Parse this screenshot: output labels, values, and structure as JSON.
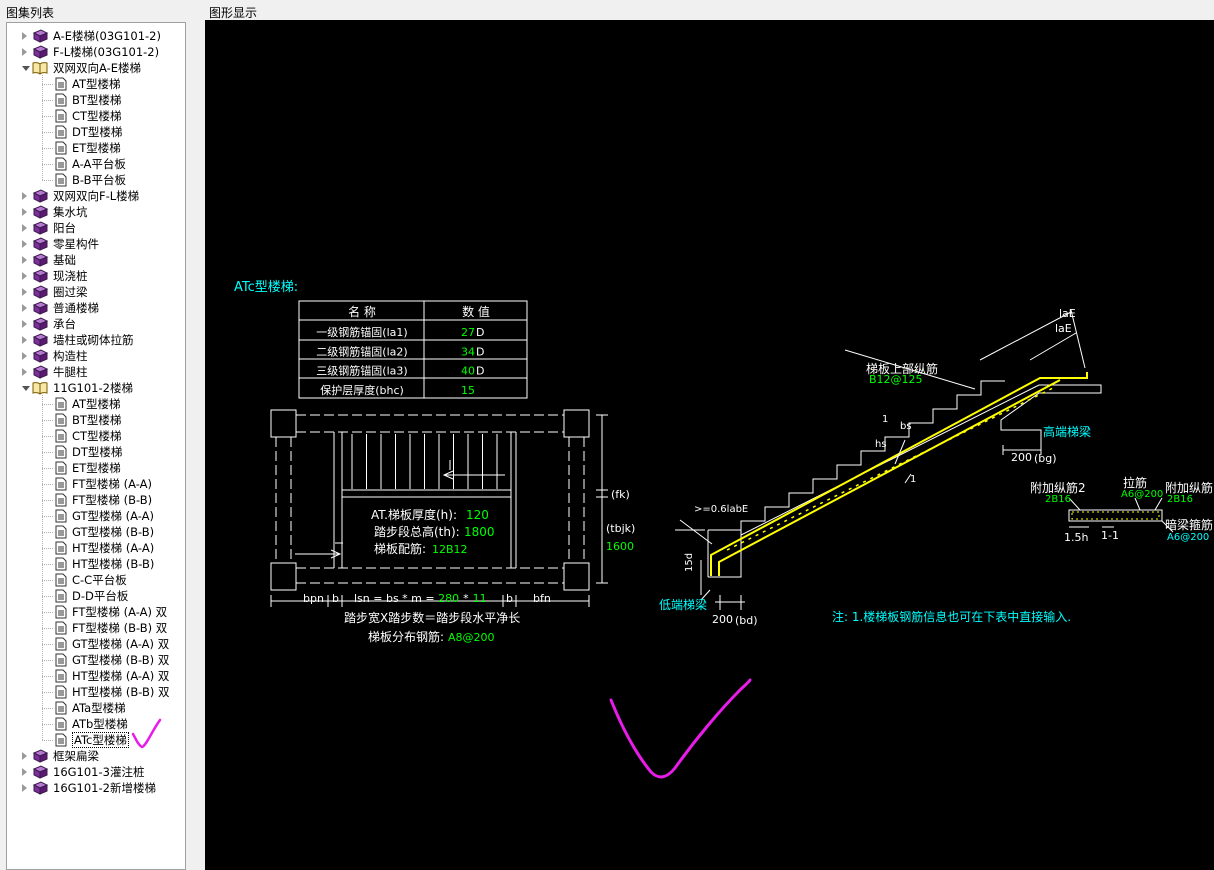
{
  "panels": {
    "left_title": "图集列表",
    "right_title": "图形显示"
  },
  "tree": [
    {
      "label": "A-E楼梯(03G101-2)",
      "level": 0,
      "type": "book",
      "expanded": false
    },
    {
      "label": "F-L楼梯(03G101-2)",
      "level": 0,
      "type": "book",
      "expanded": false
    },
    {
      "label": "双网双向A-E楼梯",
      "level": 0,
      "type": "book-open",
      "expanded": true
    },
    {
      "label": "AT型楼梯",
      "level": 1,
      "type": "doc"
    },
    {
      "label": "BT型楼梯",
      "level": 1,
      "type": "doc"
    },
    {
      "label": "CT型楼梯",
      "level": 1,
      "type": "doc"
    },
    {
      "label": "DT型楼梯",
      "level": 1,
      "type": "doc"
    },
    {
      "label": "ET型楼梯",
      "level": 1,
      "type": "doc"
    },
    {
      "label": "A-A平台板",
      "level": 1,
      "type": "doc"
    },
    {
      "label": "B-B平台板",
      "level": 1,
      "type": "doc"
    },
    {
      "label": "双网双向F-L楼梯",
      "level": 0,
      "type": "book",
      "expanded": false
    },
    {
      "label": "集水坑",
      "level": 0,
      "type": "book",
      "expanded": false
    },
    {
      "label": "阳台",
      "level": 0,
      "type": "book",
      "expanded": false
    },
    {
      "label": "零星构件",
      "level": 0,
      "type": "book",
      "expanded": false
    },
    {
      "label": "基础",
      "level": 0,
      "type": "book",
      "expanded": false
    },
    {
      "label": "现浇桩",
      "level": 0,
      "type": "book",
      "expanded": false
    },
    {
      "label": "圈过梁",
      "level": 0,
      "type": "book",
      "expanded": false
    },
    {
      "label": "普通楼梯",
      "level": 0,
      "type": "book",
      "expanded": false
    },
    {
      "label": "承台",
      "level": 0,
      "type": "book",
      "expanded": false
    },
    {
      "label": "墙柱或砌体拉筋",
      "level": 0,
      "type": "book",
      "expanded": false
    },
    {
      "label": "构造柱",
      "level": 0,
      "type": "book",
      "expanded": false
    },
    {
      "label": "牛腿柱",
      "level": 0,
      "type": "book",
      "expanded": false
    },
    {
      "label": "11G101-2楼梯",
      "level": 0,
      "type": "book-open",
      "expanded": true
    },
    {
      "label": "AT型楼梯",
      "level": 1,
      "type": "doc"
    },
    {
      "label": "BT型楼梯",
      "level": 1,
      "type": "doc"
    },
    {
      "label": "CT型楼梯",
      "level": 1,
      "type": "doc"
    },
    {
      "label": "DT型楼梯",
      "level": 1,
      "type": "doc"
    },
    {
      "label": "ET型楼梯",
      "level": 1,
      "type": "doc"
    },
    {
      "label": "FT型楼梯 (A-A)",
      "level": 1,
      "type": "doc"
    },
    {
      "label": "FT型楼梯 (B-B)",
      "level": 1,
      "type": "doc"
    },
    {
      "label": "GT型楼梯 (A-A)",
      "level": 1,
      "type": "doc"
    },
    {
      "label": "GT型楼梯 (B-B)",
      "level": 1,
      "type": "doc"
    },
    {
      "label": "HT型楼梯 (A-A)",
      "level": 1,
      "type": "doc"
    },
    {
      "label": "HT型楼梯 (B-B)",
      "level": 1,
      "type": "doc"
    },
    {
      "label": "C-C平台板",
      "level": 1,
      "type": "doc"
    },
    {
      "label": "D-D平台板",
      "level": 1,
      "type": "doc"
    },
    {
      "label": "FT型楼梯 (A-A) 双",
      "level": 1,
      "type": "doc"
    },
    {
      "label": "FT型楼梯 (B-B) 双",
      "level": 1,
      "type": "doc"
    },
    {
      "label": "GT型楼梯 (A-A) 双",
      "level": 1,
      "type": "doc"
    },
    {
      "label": "GT型楼梯 (B-B) 双",
      "level": 1,
      "type": "doc"
    },
    {
      "label": "HT型楼梯 (A-A) 双",
      "level": 1,
      "type": "doc"
    },
    {
      "label": "HT型楼梯 (B-B) 双",
      "level": 1,
      "type": "doc"
    },
    {
      "label": "ATa型楼梯",
      "level": 1,
      "type": "doc"
    },
    {
      "label": "ATb型楼梯",
      "level": 1,
      "type": "doc"
    },
    {
      "label": "ATc型楼梯",
      "level": 1,
      "type": "doc",
      "selected": true
    },
    {
      "label": "框架扁梁",
      "level": 0,
      "type": "book",
      "expanded": false
    },
    {
      "label": "16G101-3灌注桩",
      "level": 0,
      "type": "book",
      "expanded": false
    },
    {
      "label": "16G101-2新增楼梯",
      "level": 0,
      "type": "book",
      "expanded": false
    }
  ],
  "drawing": {
    "title": "ATc型楼梯:",
    "table": {
      "headers": [
        "名  称",
        "数  值"
      ],
      "rows": [
        {
          "name": "一级钢筋锚固(la1)",
          "value": "27",
          "unit": "D"
        },
        {
          "name": "二级钢筋锚固(la2)",
          "value": "34",
          "unit": "D"
        },
        {
          "name": "三级钢筋锚固(la3)",
          "value": "40",
          "unit": "D"
        },
        {
          "name": "保护层厚度(bhc)",
          "value": "15",
          "unit": ""
        }
      ]
    },
    "plan": {
      "thickness_label": "AT.梯板厚度(h):",
      "thickness_value": "120",
      "height_label": "踏步段总高(th):",
      "height_value": "1800",
      "rebar_label": "梯板配筋:",
      "rebar_value": "12B12",
      "fk": "(fk)",
      "tbjk": "(tbjk)",
      "width_value": "1600",
      "bpn": "bpn",
      "b1": "b",
      "b2": "b",
      "bfn": "bfn",
      "lsn_formula": "lsn = bs * m = ",
      "bs_value": "280",
      "times": "*",
      "m_value": "11",
      "caption": "踏步宽X踏步数＝踏步段水平净长",
      "dist_label": "梯板分布钢筋:",
      "dist_value": "A8@200"
    },
    "section": {
      "top_rebar_label": "梯板上部纵筋",
      "top_rebar_value": "B12@125",
      "laE1": "laE",
      "laE2": "laE",
      "high_beam": "高端梯梁",
      "high_beam_w": "200",
      "high_beam_bg": "(bg)",
      "low_beam": "低端梯梁",
      "low_beam_w": "200",
      "low_beam_bd": "(bd)",
      "hs": "hs",
      "bs": "bs",
      "one1": "1",
      "one2": "1",
      "anchor": ">=0.6labE",
      "fifteen_d": "15d"
    },
    "detail": {
      "add_bar2_label": "附加纵筋2",
      "add_bar2_value": "2B16",
      "tie_label": "拉筋",
      "tie_value": "A6@200",
      "add_bar_label": "附加纵筋",
      "add_bar_value": "2B16",
      "stirrup_label": "暗梁箍筋",
      "stirrup_value": "A6@200",
      "dim": "1.5h",
      "section": "1-1"
    },
    "note": "注: 1.楼梯板钢筋信息也可在下表中直接输入."
  },
  "colors": {
    "cad_bg": "#000000",
    "cad_line": "#ffffff",
    "cad_value": "#00ff00",
    "cad_label_cyan": "#00ffff",
    "rebar_yellow": "#ffff00",
    "annotation_magenta": "#e81ce8"
  }
}
